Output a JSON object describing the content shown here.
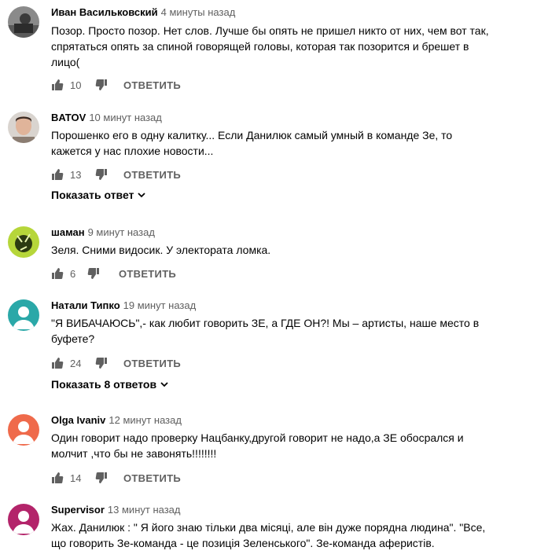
{
  "comments": [
    {
      "author": "Иван Васильковский",
      "time": "4 минуты назад",
      "lines": [
        "Позор. Просто позор. Нет слов. Лучше бы опять не пришел никто от них, чем вот так,",
        "спрятаться опять за спиной говорящей головы, которая так позорится и брешет в",
        "лицо("
      ],
      "likes": "10",
      "reply": "ОТВЕТИТЬ"
    },
    {
      "author": "BATOV",
      "time": "10 минут назад",
      "lines": [
        "Порошенко его в одну калитку... Если Данилюк самый умный в команде Зе, то",
        "кажется у нас плохие новости..."
      ],
      "likes": "13",
      "reply": "ОТВЕТИТЬ",
      "replies_link": "Показать ответ"
    },
    {
      "author": "шаман",
      "time": "9 минут назад",
      "lines": [
        "Зеля. Сними видосик. У электората ломка."
      ],
      "likes": "6",
      "reply": "ОТВЕТИТЬ"
    },
    {
      "author": "Натали Типко",
      "time": "19 минут назад",
      "lines": [
        "\"Я ВИБАЧАЮСЬ\",- как любит говорить ЗЕ, а ГДЕ ОН?! Мы – артисты, наше место в",
        "буфете?"
      ],
      "likes": "24",
      "reply": "ОТВЕТИТЬ",
      "replies_link": "Показать 8 ответов"
    },
    {
      "author": "Olga Ivaniv",
      "time": "12 минут назад",
      "lines": [
        "Один говорит надо проверку Нацбанку,другой говорит не надо,а ЗЕ обосрался и",
        "молчит ,что бы не завонять!!!!!!!!"
      ],
      "likes": "14",
      "reply": "ОТВЕТИТЬ"
    },
    {
      "author": "Supervisor",
      "time": "13 минут назад",
      "lines": [
        "Жах. Данилюк : \" Я його знаю тільки два місяці, але він дуже порядна людина\". \"Все,",
        "що говорить Зе-команда - це позиція Зеленського\".  Зе-команда аферистів."
      ]
    }
  ],
  "colors": {
    "avatar_teal": "#2aa8a8",
    "avatar_coral": "#ef6a4b",
    "avatar_magenta": "#b3246a",
    "meta_gray": "#606060"
  }
}
